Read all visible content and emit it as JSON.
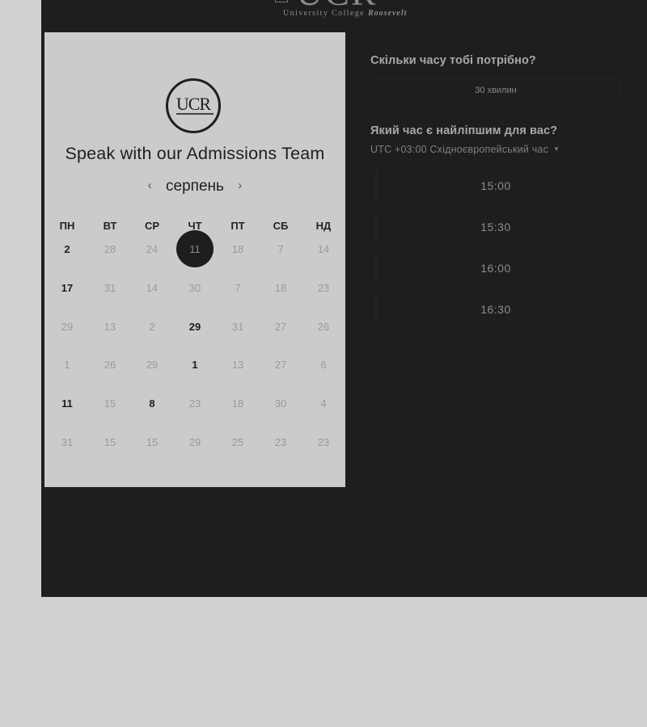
{
  "header": {
    "logo_text": "UCR",
    "logo_subtitle": "University College",
    "logo_subtitle_name": "Roosevelt"
  },
  "calendar": {
    "logo_text": "UCR",
    "title": "Speak with our Admissions Team",
    "month": "серпень",
    "prev_icon": "chevron-left-icon",
    "next_icon": "chevron-right-icon",
    "weekdays": [
      "ПН",
      "ВТ",
      "СР",
      "ЧТ",
      "ПТ",
      "СБ",
      "НД"
    ],
    "rows": [
      [
        "2",
        "28",
        "24",
        "11",
        "18",
        "7",
        "14"
      ],
      [
        "17",
        "31",
        "14",
        "30",
        "7",
        "18",
        "23"
      ],
      [
        "29",
        "13",
        "2",
        "29",
        "31",
        "27",
        "26"
      ],
      [
        "1",
        "26",
        "29",
        "1",
        "13",
        "27",
        "6"
      ],
      [
        "11",
        "15",
        "8",
        "23",
        "18",
        "30",
        "4"
      ],
      [
        "31",
        "15",
        "15",
        "29",
        "25",
        "23",
        "23"
      ]
    ],
    "active_cells": [
      [
        0,
        0
      ],
      [
        1,
        0
      ],
      [
        2,
        3
      ],
      [
        3,
        3
      ],
      [
        4,
        0
      ],
      [
        4,
        2
      ]
    ],
    "selected_cell": [
      0,
      3
    ]
  },
  "booking": {
    "duration_heading": "Скільки часу тобі потрібно?",
    "duration_value": "30 хвилин",
    "time_heading": "Який час є найліпшим для вас?",
    "timezone": "UTC +03:00 Східноєвропейський час",
    "timezone_caret_icon": "caret-down-icon",
    "slots": [
      "15:00",
      "15:30",
      "16:00",
      "16:30"
    ]
  },
  "colors": {
    "dark_panel": "#1e1e1e",
    "card": "#cbcbcb",
    "background": "#d0d0d0"
  }
}
